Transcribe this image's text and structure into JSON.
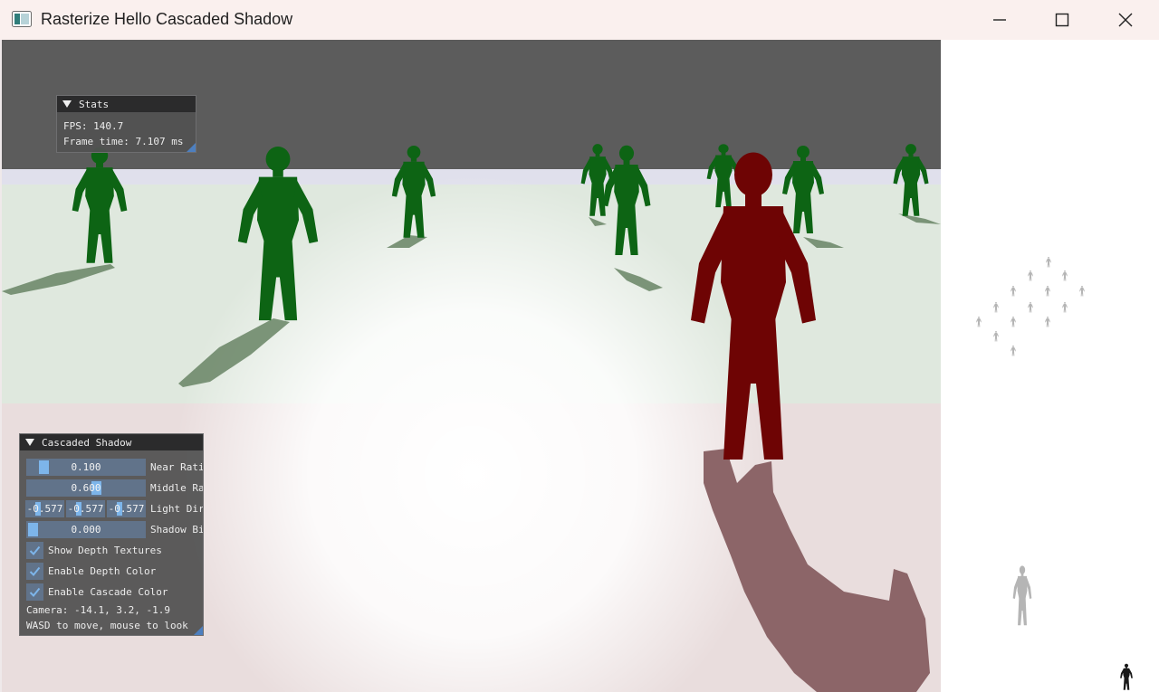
{
  "window": {
    "title": "Rasterize Hello Cascaded Shadow",
    "controls": {
      "minimize": "minimize",
      "maximize": "maximize",
      "close": "close"
    }
  },
  "stats": {
    "title": "Stats",
    "fps": "FPS: 140.7",
    "frame_time": "Frame time: 7.107 ms"
  },
  "cascaded_shadow": {
    "title": "Cascaded Shadow",
    "near_ratio": {
      "value": "0.100",
      "label": "Near Ratio",
      "fraction": 0.1
    },
    "middle_ratio": {
      "value": "0.600",
      "label": "Middle Ratio",
      "fraction": 0.6
    },
    "light_dir": {
      "x": "-0.577",
      "y": "-0.577",
      "z": "-0.577",
      "label": "Light Dir"
    },
    "shadow_bias": {
      "value": "0.000",
      "label": "Shadow Bias",
      "fraction": 0.0
    },
    "checkboxes": [
      {
        "label": "Show Depth Textures",
        "checked": true
      },
      {
        "label": "Enable Depth Color",
        "checked": true
      },
      {
        "label": "Enable Cascade Color",
        "checked": true
      }
    ],
    "camera": "Camera: -14.1, 3.2, -1.9",
    "hint": "WASD to move, mouse to look"
  },
  "colors": {
    "sky": "#5c5c5c",
    "near_cascade": "#e9dddd",
    "middle_cascade": "#dfe8de",
    "far_cascade": "#e0e0ec",
    "main_character": "#6e0404",
    "other_characters": "#0d6414",
    "accent": "#7db5ea"
  }
}
